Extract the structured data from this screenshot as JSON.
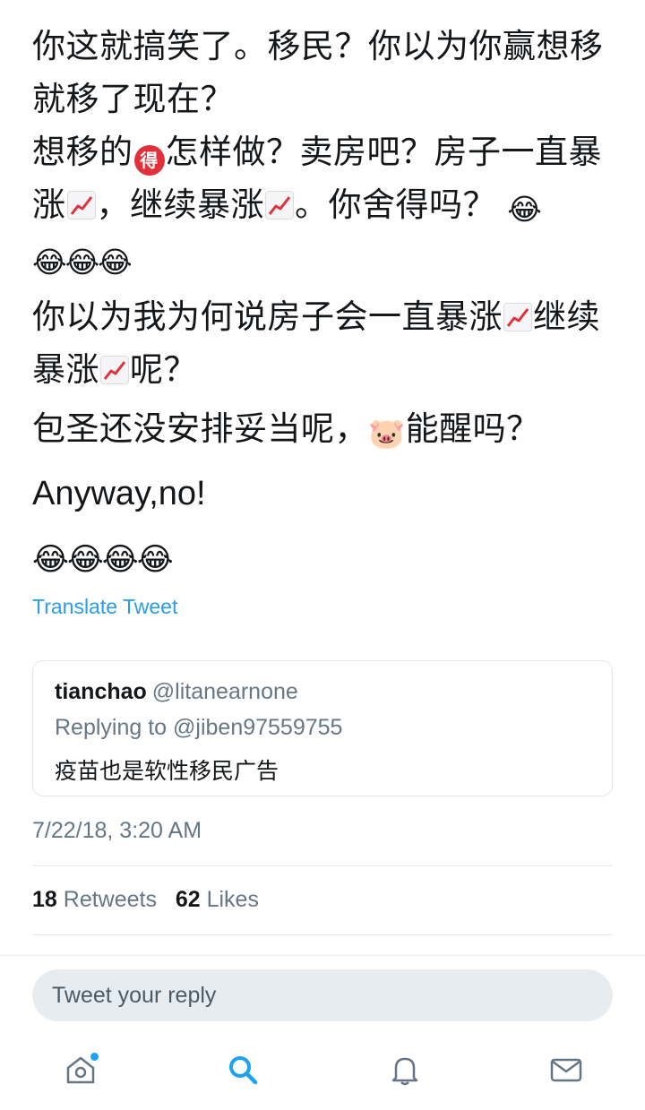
{
  "tweet": {
    "p1": "你这就搞笑了。移民？你以为你赢想移就移了现在？",
    "p2_pre": "想移的",
    "p2_emoji_de": "得",
    "p2_mid": "怎样做？卖房吧？房子一直暴涨",
    "p2_mid2": "，继续暴涨",
    "p2_end": "。你舍得吗？",
    "laugh": "😂",
    "p3_pre": "你以为我为何说房子会一直暴涨",
    "p3_mid": "继续暴涨",
    "p3_end": "呢？",
    "p4_pre": "包圣还没安排妥当呢，",
    "p4_emoji": "🐷",
    "p4_end": "能醒吗？",
    "p5": "Anyway,no!",
    "laugh_row": "😂😂😂😂",
    "translate_label": "Translate Tweet"
  },
  "quote": {
    "name": "tianchao",
    "handle": "@litanearnone",
    "replying": "Replying to @jiben97559755",
    "text": "疫苗也是软性移民广告"
  },
  "meta": {
    "timestamp": "7/22/18, 3:20 AM",
    "retweets_count": "18",
    "retweets_label": "Retweets",
    "likes_count": "62",
    "likes_label": "Likes"
  },
  "reply": {
    "placeholder": "Tweet your reply"
  },
  "tabs": [
    "home-icon",
    "search-icon",
    "notifications-icon",
    "messages-icon"
  ],
  "colors": {
    "accent": "#1da1f2",
    "link": "#2a9de8",
    "muted": "#657786"
  }
}
